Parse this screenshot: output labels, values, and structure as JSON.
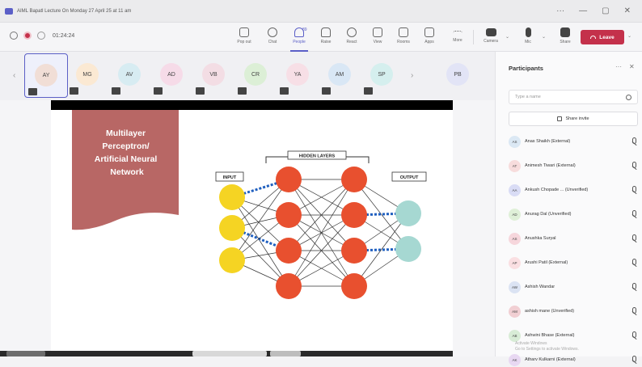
{
  "window": {
    "title": "AIML Bapatl Lecture On Monday 27 April 25 at 11 am"
  },
  "toolbar": {
    "timer": "01:24:24",
    "buttons": [
      "Pop out",
      "Chat",
      "People",
      "Raise",
      "React",
      "View",
      "Rooms",
      "Apps",
      "More",
      "Camera",
      "Mic",
      "Share"
    ],
    "people_count": "89",
    "leave_label": "Leave"
  },
  "strip": {
    "tiles": [
      {
        "initials": "AY",
        "color": "#f1ded6"
      },
      {
        "initials": "MG",
        "color": "#fbe9d3"
      },
      {
        "initials": "AV",
        "color": "#d7ecf2"
      },
      {
        "initials": "AD",
        "color": "#f6dbe8"
      },
      {
        "initials": "VB",
        "color": "#f3dde4"
      },
      {
        "initials": "CR",
        "color": "#dcefd6"
      },
      {
        "initials": "YA",
        "color": "#f7dfe6"
      },
      {
        "initials": "AM",
        "color": "#d9e7f5"
      },
      {
        "initials": "SP",
        "color": "#d5efee"
      }
    ],
    "overflow_tile": {
      "initials": "PB",
      "color": "#e2e4f6"
    }
  },
  "slide": {
    "title_lines": [
      "Multilayer",
      "Perceptron/",
      "Artificial Neural",
      "Network"
    ],
    "label_input": "INPUT",
    "label_hidden": "HIDDEN LAYERS",
    "label_output": "OUTPUT",
    "colors": {
      "banner": "#b86765",
      "input": "#f5d423",
      "hidden": "#e8502f",
      "output": "#a6d8d2",
      "highlight": "#1f5fbf"
    }
  },
  "panel": {
    "title": "Participants",
    "search_placeholder": "Type a name",
    "share_invite": "Share invite",
    "participants": [
      {
        "initials": "AS",
        "name": "Anas Shaikh (External)",
        "color": "#dbe8f4"
      },
      {
        "initials": "AT",
        "name": "Animesh Tiwari (External)",
        "color": "#f7dcdc"
      },
      {
        "initials": "AA",
        "name": "Ankush Chopade ... (Unverified)",
        "color": "#d9dcf5"
      },
      {
        "initials": "AD",
        "name": "Anurag Dal (Unverified)",
        "color": "#dff0d8"
      },
      {
        "initials": "AS",
        "name": "Anushka Suryal",
        "color": "#f6d6dc"
      },
      {
        "initials": "AP",
        "name": "Arushi Patil (External)",
        "color": "#fadfe2"
      },
      {
        "initials": "AW",
        "name": "Ashish Wandar",
        "color": "#dbe3f3"
      },
      {
        "initials": "AM",
        "name": "ashish mane (Unverified)",
        "color": "#f1cfd3"
      },
      {
        "initials": "AB",
        "name": "Ashwini Bhase (External)",
        "color": "#d8ecd6"
      },
      {
        "initials": "AK",
        "name": "Atharv Kulkarni (External)",
        "color": "#e8d8f2"
      }
    ],
    "watermark": [
      "Activate Windows",
      "Go to Settings to activate Windows."
    ]
  }
}
